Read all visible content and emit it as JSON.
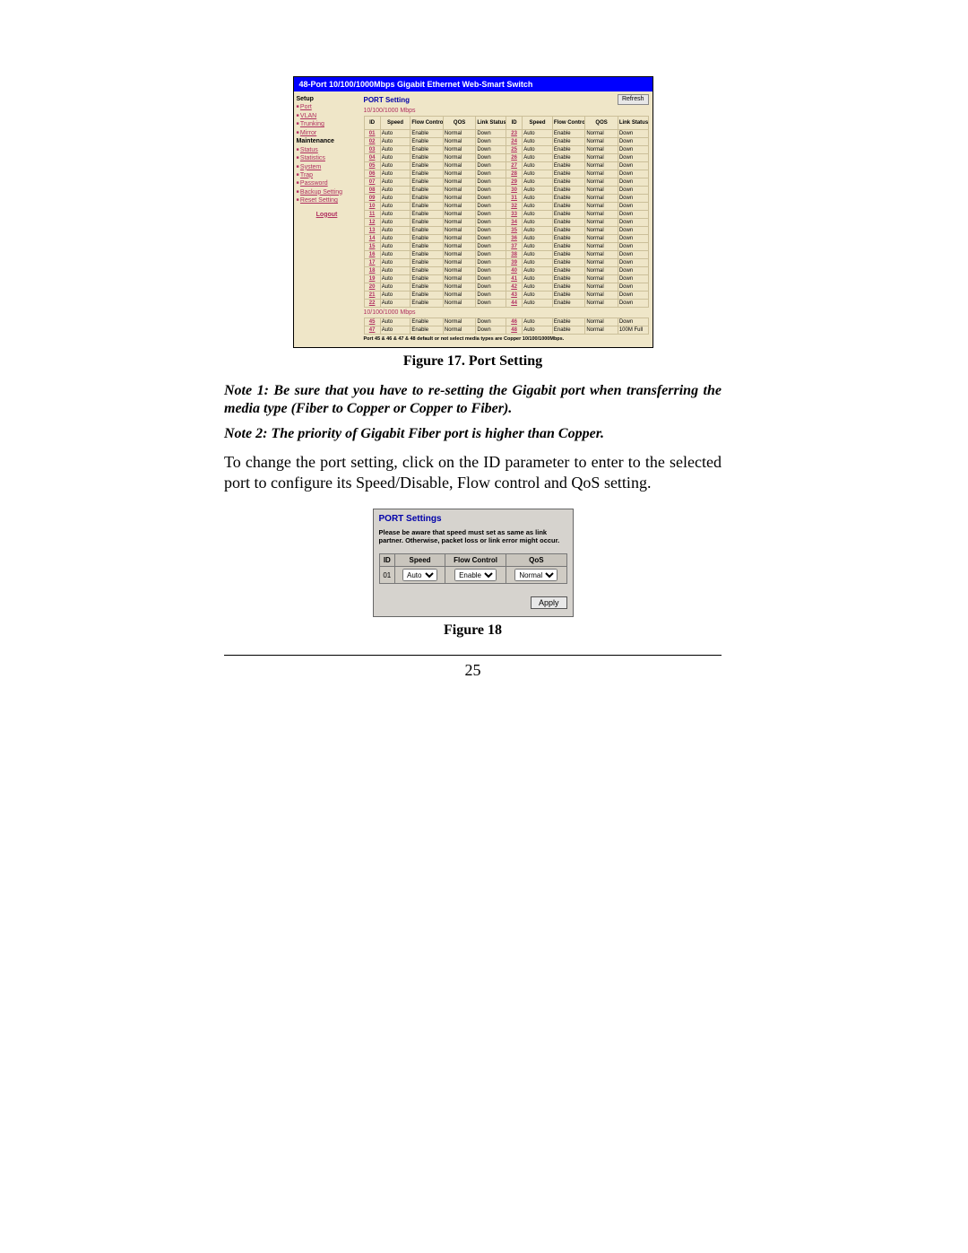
{
  "fig17": {
    "banner": "48-Port 10/100/1000Mbps Gigabit Ethernet Web-Smart Switch",
    "side": {
      "setup": "Setup",
      "items_setup": [
        "Port",
        "VLAN",
        "Trunking",
        "Mirror"
      ],
      "maintenance": "Maintenance",
      "items_maint": [
        "Status",
        "Statistics",
        "System",
        "Trap",
        "Password",
        "Backup Setting",
        "Reset Setting"
      ],
      "logout": "Logout"
    },
    "header": "PORT Setting",
    "refresh": "Refresh",
    "subheader1": "10/100/1000 Mbps",
    "subheader2": "10/100/1000 Mbps",
    "cols": [
      "ID",
      "Speed",
      "Flow Control",
      "QOS",
      "Link Status"
    ],
    "default_row": {
      "speed": "Auto",
      "flow": "Enable",
      "qos": "Normal",
      "link": "Down"
    },
    "left_ids": [
      "01",
      "02",
      "03",
      "04",
      "05",
      "06",
      "07",
      "08",
      "09",
      "10",
      "11",
      "12",
      "13",
      "14",
      "15",
      "16",
      "17",
      "18",
      "19",
      "20",
      "21",
      "22"
    ],
    "right_ids": [
      "23",
      "24",
      "25",
      "26",
      "27",
      "28",
      "29",
      "30",
      "31",
      "32",
      "33",
      "34",
      "35",
      "36",
      "37",
      "38",
      "39",
      "40",
      "41",
      "42",
      "43",
      "44"
    ],
    "left_ids2": [
      "45",
      "47"
    ],
    "right_ids2": [
      "46",
      "48"
    ],
    "last_link": "100M Full",
    "footnote": "Port 45 & 46 & 47 & 48 default or not select media types are Copper 10/100/1000Mbps."
  },
  "caption17": "Figure 17. Port Setting",
  "note1": "Note 1: Be sure that you have to re-setting the Gigabit port when transferring the media type (Fiber to Copper or Copper to Fiber).",
  "note2": "Note 2: The priority of Gigabit Fiber port is higher than Copper.",
  "paragraph": "To change the port setting, click on the ID parameter to enter to the selected port to configure its Speed/Disable, Flow control and QoS setting.",
  "fig18": {
    "title": "PORT Settings",
    "warn": "Please be aware that speed must set as same as link partner. Otherwise, packet loss or link error might occur.",
    "cols": [
      "ID",
      "Speed",
      "Flow Control",
      "QoS"
    ],
    "id": "01",
    "speed": "Auto",
    "flow": "Enable",
    "qos": "Normal",
    "apply": "Apply"
  },
  "caption18": "Figure 18",
  "page_number": "25"
}
